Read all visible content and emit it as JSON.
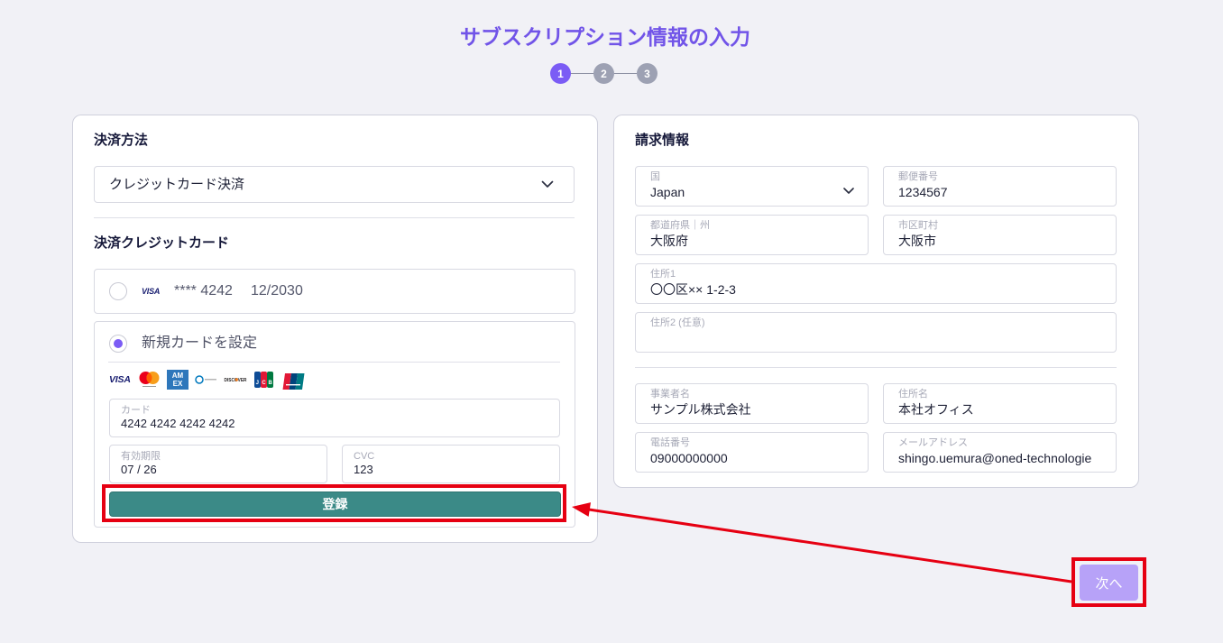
{
  "page": {
    "title": "サブスクリプション情報の入力"
  },
  "stepper": {
    "steps": [
      "1",
      "2",
      "3"
    ],
    "current_step": 1
  },
  "payment": {
    "method_label": "決済方法",
    "method_value": "クレジットカード決済",
    "card_heading": "決済クレジットカード",
    "saved_card": {
      "brand": "VISA",
      "number": "**** 4242",
      "expiry": "12/2030",
      "selected": false
    },
    "new_card": {
      "label": "新規カードを設定",
      "selected": true,
      "brands": [
        {
          "icon": "visa-logo",
          "text": "VISA"
        },
        {
          "icon": "mastercard-logo"
        },
        {
          "icon": "amex-logo",
          "lines": [
            "AM",
            "EX"
          ]
        },
        {
          "icon": "diners-club-logo"
        },
        {
          "icon": "discover-logo",
          "text": "DISCOVER"
        },
        {
          "icon": "jcb-logo",
          "letters": [
            "J",
            "C",
            "B"
          ]
        },
        {
          "icon": "unionpay-logo"
        }
      ],
      "card_number": {
        "label": "カード",
        "value": "4242 4242 4242 4242"
      },
      "expiry": {
        "label": "有効期限",
        "value": "07 / 26"
      },
      "cvc": {
        "label": "CVC",
        "value": "123"
      },
      "register_label": "登録"
    }
  },
  "billing": {
    "heading": "請求情報",
    "country": {
      "label": "国",
      "value": "Japan"
    },
    "postal_code": {
      "label": "郵便番号",
      "value": "1234567"
    },
    "prefecture": {
      "label": "都道府県｜州",
      "value": "大阪府"
    },
    "city": {
      "label": "市区町村",
      "value": "大阪市"
    },
    "address1": {
      "label": "住所1",
      "value": "〇〇区×× 1-2-3"
    },
    "address2": {
      "label": "住所2 (任意)",
      "value": ""
    },
    "company": {
      "label": "事業者名",
      "value": "サンプル株式会社"
    },
    "address_name": {
      "label": "住所名",
      "value": "本社オフィス"
    },
    "phone": {
      "label": "電話番号",
      "value": "09000000000"
    },
    "email": {
      "label": "メールアドレス",
      "value": "shingo.uemura@oned-technologie"
    }
  },
  "next_label": "次へ",
  "colors": {
    "background": "#f1f1f6",
    "accent": "#7b5cf5",
    "title": "#7154e8",
    "step_inactive": "#9da1b3",
    "register_button": "#3b8a87",
    "next_button": "#b7a2f8",
    "annotation": "#e60012"
  },
  "icons": [
    "chevron-down-icon",
    "radio-icon",
    "arrow-icon"
  ]
}
